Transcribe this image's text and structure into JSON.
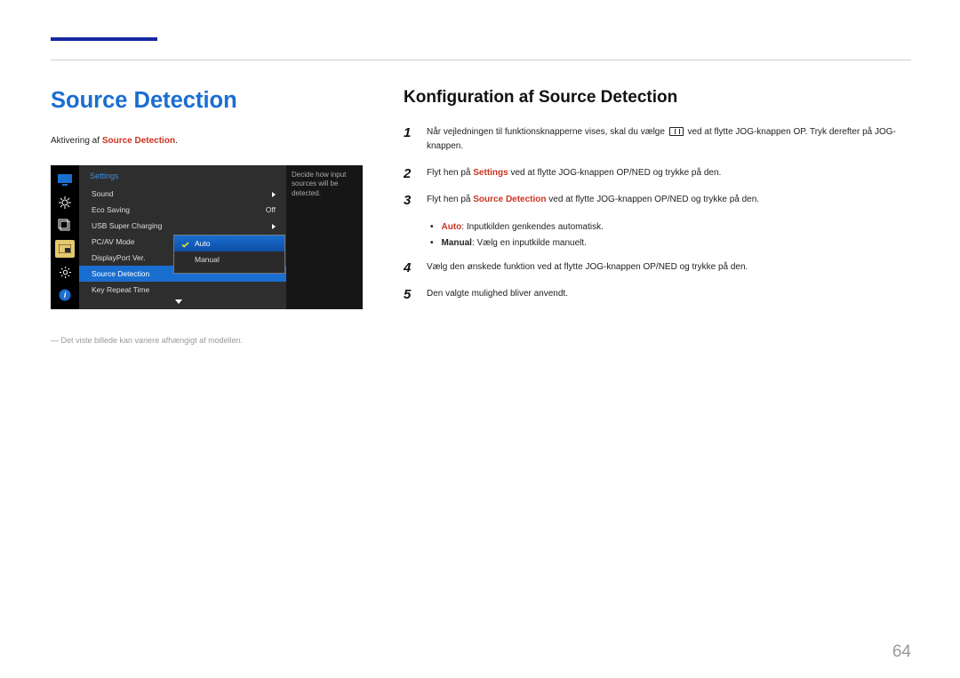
{
  "header": {
    "title": "Source Detection"
  },
  "left": {
    "subhead_prefix": "Aktivering af ",
    "subhead_em": "Source Detection",
    "subhead_suffix": ".",
    "footnote": "Det viste billede kan variere afhængigt af modellen."
  },
  "osd": {
    "title": "Settings",
    "rows": {
      "sound": {
        "label": "Sound",
        "value": "▶"
      },
      "eco": {
        "label": "Eco Saving",
        "value": "Off"
      },
      "usb": {
        "label": "USB Super Charging",
        "value": "▶"
      },
      "pcav": {
        "label": "PC/AV Mode",
        "value": "▶"
      },
      "dp": {
        "label": "DisplayPort Ver.",
        "value": "▶"
      },
      "sd": {
        "label": "Source Detection",
        "value": ""
      },
      "key": {
        "label": "Key Repeat Time",
        "value": ""
      }
    },
    "submenu": {
      "auto": "Auto",
      "manual": "Manual"
    },
    "tooltip_l1": "Decide how input",
    "tooltip_l2": "sources will be",
    "tooltip_l3": "detected."
  },
  "right": {
    "title": "Konfiguration af Source Detection",
    "steps": {
      "s1_a": "Når vejledningen til funktionsknapperne vises, skal du vælge ",
      "s1_b": " ved at flytte JOG-knappen OP. Tryk derefter på JOG-knappen.",
      "s2_a": "Flyt hen på ",
      "s2_em": "Settings",
      "s2_b": " ved at flytte JOG-knappen OP/NED og trykke på den.",
      "s3_a": "Flyt hen på ",
      "s3_em": "Source Detection",
      "s3_b": " ved at flytte JOG-knappen OP/NED og trykke på den.",
      "s4": "Vælg den ønskede funktion ved at flytte JOG-knappen OP/NED og trykke på den.",
      "s5": "Den valgte mulighed bliver anvendt."
    },
    "bullets": {
      "b1_em": "Auto",
      "b1_txt": ": Inputkilden genkendes automatisk.",
      "b2_bold": "Manual",
      "b2_txt": ": Vælg en inputkilde manuelt."
    },
    "nums": {
      "n1": "1",
      "n2": "2",
      "n3": "3",
      "n4": "4",
      "n5": "5"
    }
  },
  "page_number": "64"
}
